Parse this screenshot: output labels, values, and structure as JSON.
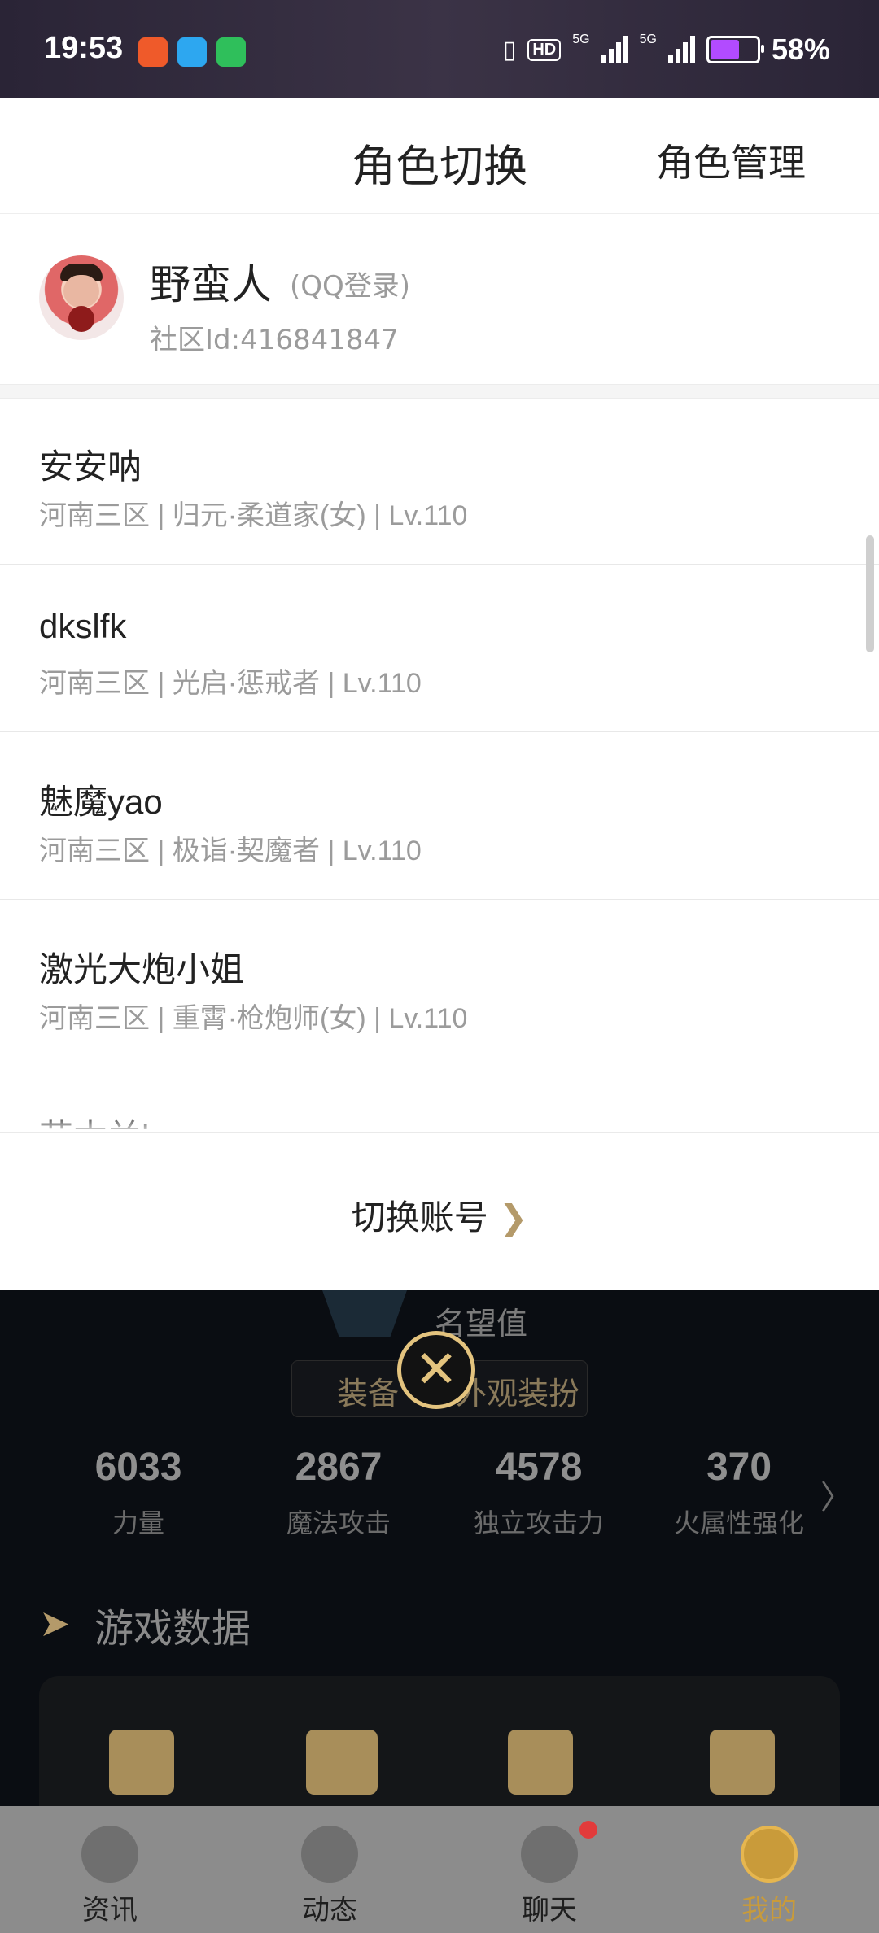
{
  "status_bar": {
    "time": "19:53",
    "battery": "58%",
    "hd": "HD",
    "net1": "5G",
    "net2": "5G"
  },
  "sheet": {
    "title": "角色切换",
    "manage_label": "角色管理",
    "user": {
      "name": "野蛮人",
      "login_type": "(QQ登录)",
      "community_id": "社区Id:416841847"
    },
    "roles": [
      {
        "name": "安安呐",
        "info": "河南三区 | 归元·柔道家(女) | Lv.110"
      },
      {
        "name": "dkslfk",
        "info": "河南三区 | 光启·惩戒者 | Lv.110"
      },
      {
        "name": "魅魔yao",
        "info": "河南三区 | 极诣·契魔者 | Lv.110"
      },
      {
        "name": "激光大炮小姐",
        "info": "河南三区 | 重霄·枪炮师(女) | Lv.110"
      },
      {
        "name": "花木兰boss",
        "info": ""
      }
    ],
    "switch_account_label": "切换账号",
    "switch_chevron": "❯"
  },
  "background": {
    "fame_label": "名望值",
    "tab_equipment": "装备",
    "tab_appearance": "外观装扮",
    "close_symbol": "✕",
    "stats": [
      {
        "value": "6033",
        "label": "力量"
      },
      {
        "value": "2867",
        "label": "魔法攻击"
      },
      {
        "value": "4578",
        "label": "独立攻击力"
      },
      {
        "value": "370",
        "label": "火属性强化"
      }
    ],
    "stats_chevron": "〉",
    "game_data_title": "游戏数据",
    "game_data_icon": "➤"
  },
  "bottom_nav": [
    {
      "label": "资讯",
      "icon": "news-icon"
    },
    {
      "label": "动态",
      "icon": "dragon-icon"
    },
    {
      "label": "聊天",
      "icon": "chat-icon"
    },
    {
      "label": "我的",
      "icon": "profile-icon"
    }
  ],
  "colors": {
    "accent_gold": "#e3c37e",
    "nav_active": "#c99b3a",
    "battery": "#b24bff"
  }
}
